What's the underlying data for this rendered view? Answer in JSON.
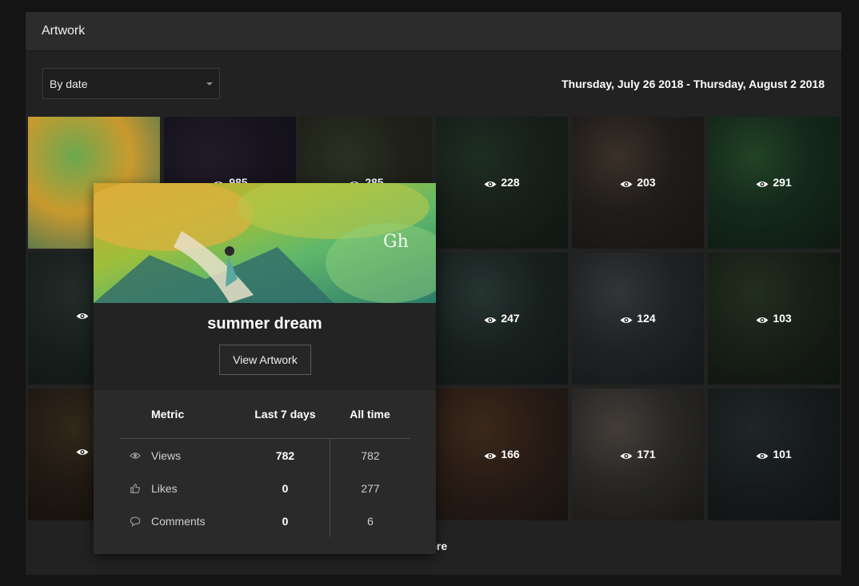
{
  "panel": {
    "title": "Artwork"
  },
  "filter": {
    "selected": "By date"
  },
  "date_range": "Thursday, July 26 2018 - Thursday, August 2 2018",
  "tiles": [
    {
      "views": "",
      "colors": [
        "#c99a2e",
        "#6aa84f",
        "#2e6b5a"
      ]
    },
    {
      "views": "985",
      "colors": [
        "#2b2438",
        "#3b3148",
        "#1d1a24"
      ]
    },
    {
      "views": "285",
      "colors": [
        "#3a3d2e",
        "#4c5a3e",
        "#2d2f26"
      ]
    },
    {
      "views": "228",
      "colors": [
        "#2a3a2f",
        "#37543f",
        "#1f2a22"
      ]
    },
    {
      "views": "203",
      "colors": [
        "#3a3430",
        "#6a5a4a",
        "#2a2826"
      ]
    },
    {
      "views": "291",
      "colors": [
        "#254a32",
        "#3f7a45",
        "#1a2e20"
      ]
    },
    {
      "views": "",
      "colors": [
        "#2a3a36",
        "#3e4f48",
        "#1d2624"
      ]
    },
    {
      "views": "",
      "colors": [
        "#2a2a2a",
        "#333333",
        "#1e1e1e"
      ]
    },
    {
      "views": "",
      "colors": [
        "#2a2a2a",
        "#333333",
        "#1e1e1e"
      ]
    },
    {
      "views": "247",
      "colors": [
        "#2c3c38",
        "#46605a",
        "#1f2a28"
      ]
    },
    {
      "views": "124",
      "colors": [
        "#3a3f42",
        "#5a6264",
        "#26292b"
      ]
    },
    {
      "views": "103",
      "colors": [
        "#2c3a2a",
        "#3f5538",
        "#1b241b"
      ]
    },
    {
      "views": "",
      "colors": [
        "#3a2e22",
        "#5a4830",
        "#241c14"
      ]
    },
    {
      "views": "",
      "colors": [
        "#2a2a2a",
        "#333333",
        "#1e1e1e"
      ]
    },
    {
      "views": "",
      "colors": [
        "#2a2a2a",
        "#333333",
        "#1e1e1e"
      ]
    },
    {
      "views": "166",
      "colors": [
        "#4a3226",
        "#6a4a30",
        "#2a2420"
      ]
    },
    {
      "views": "171",
      "colors": [
        "#4a4844",
        "#7a7068",
        "#2c2a28"
      ]
    },
    {
      "views": "101",
      "colors": [
        "#2a3234",
        "#3a4648",
        "#1c2224"
      ]
    }
  ],
  "partial_labels": {
    "row2_left": "",
    "row3_left": "",
    "row1_b": "985",
    "row1_c": "285"
  },
  "load_more": "more",
  "popover": {
    "title": "summer dream",
    "button": "View Artwork",
    "headers": {
      "metric": "Metric",
      "last7": "Last 7 days",
      "alltime": "All time"
    },
    "rows": [
      {
        "icon": "eye-icon",
        "metric": "Views",
        "last7": "782",
        "alltime": "782"
      },
      {
        "icon": "thumbs-up-icon",
        "metric": "Likes",
        "last7": "0",
        "alltime": "277"
      },
      {
        "icon": "comment-icon",
        "metric": "Comments",
        "last7": "0",
        "alltime": "6"
      }
    ]
  },
  "accent": "#ffffff"
}
